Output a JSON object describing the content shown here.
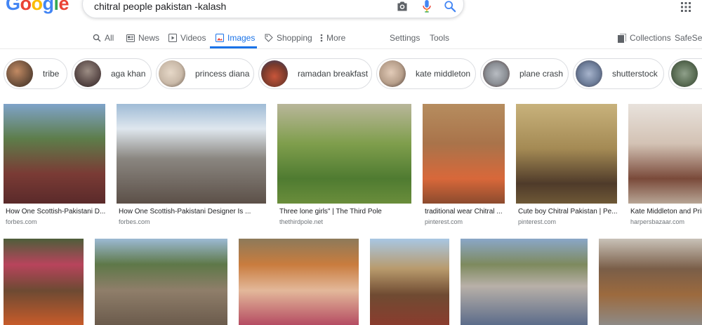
{
  "header": {
    "logo": [
      "G",
      "o",
      "o",
      "g",
      "l",
      "e"
    ],
    "logo_colors": [
      "#4285f4",
      "#ea4335",
      "#fbbc05",
      "#4285f4",
      "#34a853",
      "#ea4335"
    ],
    "query": "chitral people pakistan  -kalash"
  },
  "tabs": {
    "all": "All",
    "news": "News",
    "videos": "Videos",
    "images": "Images",
    "shopping": "Shopping",
    "more": "More",
    "settings": "Settings",
    "tools": "Tools",
    "collections": "Collections",
    "safesearch": "SafeSear"
  },
  "chips": [
    {
      "label": "tribe",
      "thumb": "#6b4f3b"
    },
    {
      "label": "aga khan",
      "thumb": "#5a4a48"
    },
    {
      "label": "princess diana",
      "thumb": "#c9b9a8"
    },
    {
      "label": "ramadan breakfast",
      "thumb": "#7a3b2c"
    },
    {
      "label": "kate middleton",
      "thumb": "#b69e8a"
    },
    {
      "label": "plane crash",
      "thumb": "#8a8e94"
    },
    {
      "label": "shutterstock",
      "thumb": "#6e7e9a"
    },
    {
      "label": "",
      "thumb": "#5b6e55"
    }
  ],
  "row1": [
    {
      "caption": "How One Scottish-Pakistani D...",
      "source": "forbes.com",
      "bg": "linear-gradient(180deg,#7fa3c9 0%,#5d7d4a 35%,#7a3b35 70%,#5a2a2a 100%)"
    },
    {
      "caption": "How One Scottish-Pakistani Designer Is ...",
      "source": "forbes.com",
      "bg": "linear-gradient(180deg,#9fbbd6 0%,#dfe7ee 25%,#8a8680 55%,#5c5048 100%)"
    },
    {
      "caption": "Three lone girls\" | The Third Pole",
      "source": "thethirdpole.net",
      "bg": "linear-gradient(180deg,#b9b69a 0%,#7f9e4c 40%,#4f7b31 75%,#6a8d3b 100%)"
    },
    {
      "caption": "traditional wear Chitral ...",
      "source": "pinterest.com",
      "bg": "linear-gradient(180deg,#b68d5f 0%,#a9734a 40%,#d8683a 75%,#8c4b2e 100%)"
    },
    {
      "caption": "Cute boy Chitral Pakistan | Pe...",
      "source": "pinterest.com",
      "bg": "linear-gradient(180deg,#c8b27c 0%,#a48a54 45%,#4f3b2a 80%,#6e5836 100%)"
    },
    {
      "caption": "Kate Middleton and Prin",
      "source": "harpersbazaar.com",
      "bg": "linear-gradient(180deg,#e8e2dc 0%,#d3c2b4 40%,#7a4a3a 75%,#b7a595 100%)"
    }
  ],
  "row2": [
    {
      "bg": "linear-gradient(180deg,#4e5e3a 0%,#b8445c 30%,#6d4a33 60%,#c75b2a 100%)"
    },
    {
      "bg": "linear-gradient(180deg,#9cbad4 0%,#5e7848 30%,#8f7e6a 60%,#6b5b4c 100%)"
    },
    {
      "bg": "linear-gradient(180deg,#8d7a5a 0%,#c97c3e 30%,#e3b89a 60%,#b54c62 100%)"
    },
    {
      "bg": "linear-gradient(180deg,#a8c7e3 0%,#b89a6c 35%,#6f4b32 65%,#8a3c2e 100%)"
    },
    {
      "bg": "linear-gradient(180deg,#8aa7c8 0%,#7e8a5e 30%,#b8b0a8 55%,#5c6c8a 100%)"
    },
    {
      "bg": "linear-gradient(180deg,#c9c2b8 0%,#7a5e48 35%,#9c6a3e 65%,#8e8a86 100%)"
    }
  ]
}
